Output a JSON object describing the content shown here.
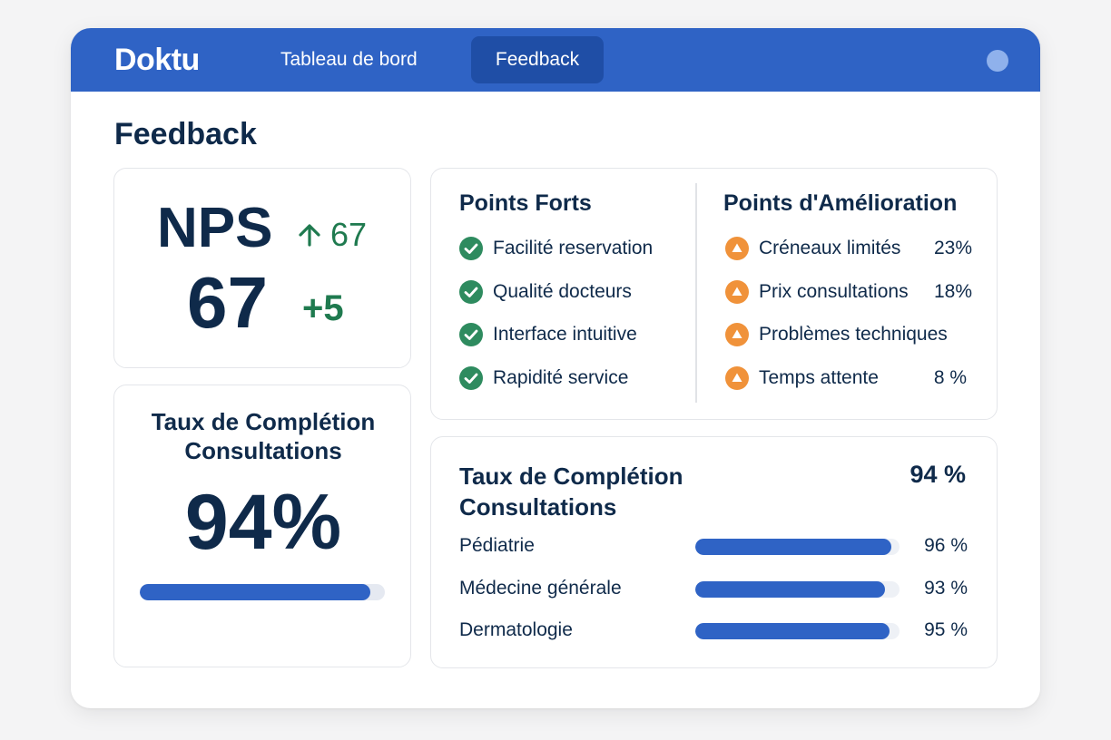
{
  "brand": "Doktu",
  "nav": {
    "tabs": [
      {
        "label": "Tableau de bord",
        "active": false
      },
      {
        "label": "Feedback",
        "active": true
      }
    ]
  },
  "page_title": "Feedback",
  "nps_card": {
    "label": "NPS",
    "trend_value": "67",
    "value": "67",
    "delta": "+5"
  },
  "completion_card": {
    "title_line1": "Taux de Complétion",
    "title_line2": "Consultations",
    "value": "94%",
    "progress": 0.94
  },
  "points_card": {
    "strengths_title": "Points Forts",
    "strengths": [
      {
        "label": "Facilité reservation"
      },
      {
        "label": "Qualité docteurs"
      },
      {
        "label": "Interface intuitive"
      },
      {
        "label": "Rapidité service"
      }
    ],
    "improvements_title": "Points d'Amélioration",
    "improvements": [
      {
        "label": "Créneaux limités",
        "pct": "23%"
      },
      {
        "label": "Prix consultations",
        "pct": "18%"
      },
      {
        "label": "Problèmes techniques",
        "pct": ""
      },
      {
        "label": "Temps attente",
        "pct": "8 %"
      }
    ]
  },
  "dept_card": {
    "title_line1": "Taux de Complétion",
    "title_line2": "Consultations",
    "total": "94 %",
    "rows": [
      {
        "name": "Pédiatrie",
        "pct": "96 %",
        "progress": 0.96
      },
      {
        "name": "Médecine générale",
        "pct": "93 %",
        "progress": 0.93
      },
      {
        "name": "Dermatologie",
        "pct": "95 %",
        "progress": 0.95
      }
    ]
  },
  "colors": {
    "primary": "#2f63c5",
    "positive": "#1f7a4f",
    "check": "#2e8b5f",
    "warning": "#f0923a",
    "text": "#0f2a4a"
  },
  "icons": {
    "trend": "arrow-up-icon",
    "strength": "check-circle-icon",
    "improvement": "warning-triangle-icon"
  }
}
